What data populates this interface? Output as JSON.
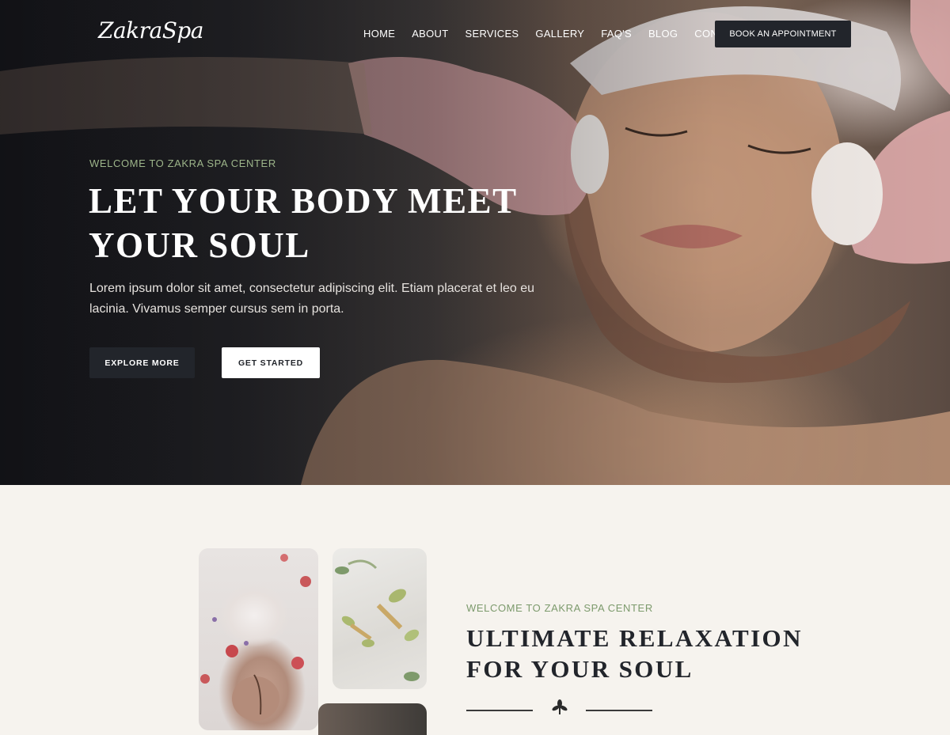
{
  "header": {
    "logo": "ZakraSpa",
    "nav": [
      "HOME",
      "ABOUT",
      "SERVICES",
      "GALLERY",
      "FAQ'S",
      "BLOG",
      "CONTACT"
    ],
    "cta": "BOOK AN APPOINTMENT"
  },
  "hero": {
    "eyebrow": "WELCOME TO ZAKRA SPA CENTER",
    "title": "LET YOUR BODY MEET YOUR SOUL",
    "description": "Lorem ipsum dolor sit amet, consectetur adipiscing elit. Etiam placerat et leo eu lacinia. Vivamus semper cursus sem in porta.",
    "primary_button": "EXPLORE MORE",
    "secondary_button": "GET STARTED"
  },
  "about": {
    "eyebrow": "WELCOME TO ZAKRA SPA CENTER",
    "title": "ULTIMATE RELAXATION FOR YOUR SOUL",
    "divider_icon": "leaf-icon"
  },
  "colors": {
    "accent_green": "#9db58a",
    "dark_button": "#22252b",
    "section_bg": "#f6f3ee"
  }
}
